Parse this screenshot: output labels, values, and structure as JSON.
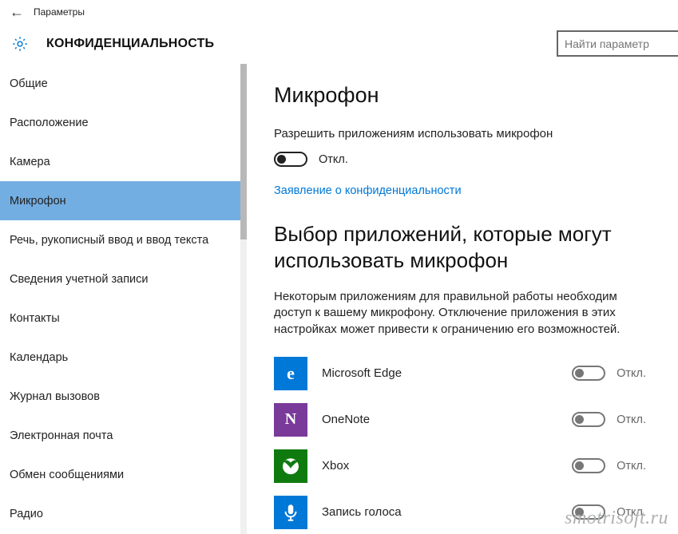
{
  "titlebar": {
    "window_title": "Параметры"
  },
  "header": {
    "title": "КОНФИДЕНЦИАЛЬНОСТЬ",
    "search_placeholder": "Найти параметр"
  },
  "sidebar": {
    "items": [
      {
        "label": "Общие"
      },
      {
        "label": "Расположение"
      },
      {
        "label": "Камера"
      },
      {
        "label": "Микрофон",
        "selected": true
      },
      {
        "label": "Речь, рукописный ввод и ввод текста"
      },
      {
        "label": "Сведения учетной записи"
      },
      {
        "label": "Контакты"
      },
      {
        "label": "Календарь"
      },
      {
        "label": "Журнал вызовов"
      },
      {
        "label": "Электронная почта"
      },
      {
        "label": "Обмен сообщениями"
      },
      {
        "label": "Радио"
      }
    ]
  },
  "content": {
    "page_title": "Микрофон",
    "allow_label": "Разрешить приложениям использовать микрофон",
    "allow_state": "Откл.",
    "privacy_link": "Заявление о конфиденциальности",
    "choose_apps_title": "Выбор приложений, которые могут использовать микрофон",
    "choose_apps_desc": "Некоторым приложениям для правильной работы необходим доступ к вашему микрофону. Отключение приложения в этих настройках может привести к ограничению его возможностей.",
    "apps": [
      {
        "name": "Microsoft Edge",
        "state": "Откл."
      },
      {
        "name": "OneNote",
        "state": "Откл."
      },
      {
        "name": "Xbox",
        "state": "Откл."
      },
      {
        "name": "Запись голоса",
        "state": "Откл."
      }
    ]
  },
  "watermark": "smotrisoft.ru"
}
